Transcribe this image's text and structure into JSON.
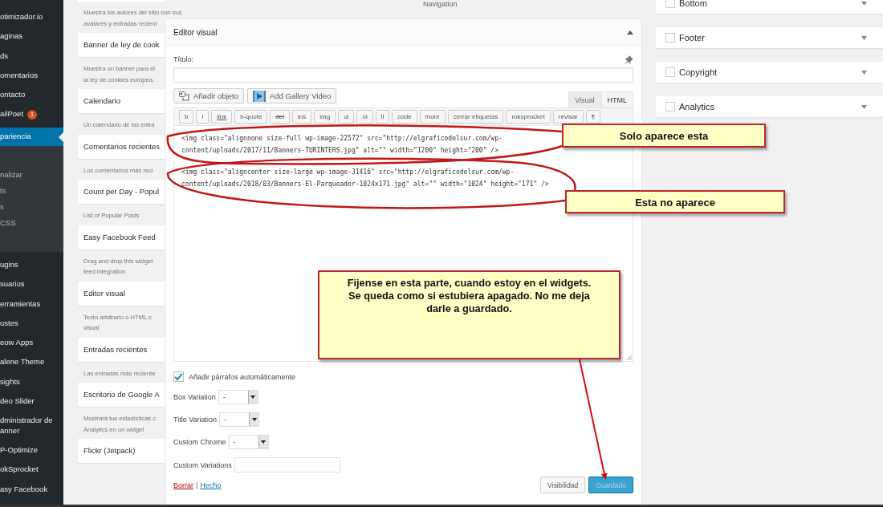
{
  "sidebar": {
    "items": [
      {
        "label": "otimizador.io",
        "selected": false
      },
      {
        "label": "aginas",
        "selected": false
      },
      {
        "label": "ds",
        "selected": false
      },
      {
        "label": "omentarios",
        "selected": false
      },
      {
        "label": "ontacto",
        "selected": false
      },
      {
        "label": "ailPoet",
        "badge": "1",
        "selected": false
      },
      {
        "label": "pariencia",
        "selected": true,
        "children": [
          {
            "label": "nalizar"
          },
          {
            "label": "ts"
          },
          {
            "label": "s"
          },
          {
            "label": "CSS"
          }
        ]
      },
      {
        "label": "ugins",
        "selected": false
      },
      {
        "label": "suarios",
        "selected": false
      },
      {
        "label": "erramientas",
        "selected": false
      },
      {
        "label": "ustes",
        "selected": false
      },
      {
        "label": "eow Apps",
        "selected": false
      },
      {
        "label": "alene Theme",
        "selected": false
      },
      {
        "label": "sights",
        "selected": false
      },
      {
        "label": "deo Slider",
        "selected": false
      },
      {
        "label": "dministrador de anner",
        "selected": false
      },
      {
        "label": "P-Optimize",
        "selected": false
      },
      {
        "label": "okSprocket",
        "selected": false
      },
      {
        "label": "asy Facebook",
        "selected": false
      }
    ]
  },
  "widgets": [
    {
      "description": [
        "Muestra los autores del sitio con sus",
        "avatares y entradas recient"
      ]
    },
    {
      "title": "Banner de ley de cook",
      "description": [
        "Muestra un banner para el",
        "la ley de cookies europea."
      ]
    },
    {
      "title": "Calendario",
      "description": [
        "Un calendario de las entra"
      ]
    },
    {
      "title": "Comentarios recientes",
      "description": [
        "Los comentarios más reci"
      ]
    },
    {
      "title": "Count per Day - Popul",
      "description": [
        "List of Popular Posts"
      ]
    },
    {
      "title": "Easy Facebook Feed",
      "description": [
        "Drag and drop this widget",
        "feed integration"
      ]
    },
    {
      "title": "Editor visual",
      "description": [
        "Texto arbitrario o HTML c",
        "visual"
      ]
    },
    {
      "title": "Entradas recientes",
      "description": [
        "Las entradas más reciente"
      ]
    },
    {
      "title": "Escritorio de Google A",
      "description": [
        "Mostrará tus estadísticas c",
        "Analytics en un widget"
      ]
    },
    {
      "title": "Flickr (Jetpack)"
    }
  ],
  "top_label": "Navigation",
  "editor": {
    "title": "Editor visual",
    "title_field": {
      "label": "Título:"
    },
    "media_buttons": [
      {
        "label": "Añadir objeto",
        "kind": "media"
      },
      {
        "label": "Add Gallery Video",
        "kind": "video"
      }
    ],
    "tabs": [
      {
        "label": "Visual",
        "selected": false
      },
      {
        "label": "HTML",
        "selected": true
      }
    ],
    "quicktags": [
      {
        "label": "b",
        "kind": "plain"
      },
      {
        "label": "i",
        "kind": "plain"
      },
      {
        "label": "link",
        "kind": "underline"
      },
      {
        "label": "b-quote",
        "kind": "plain"
      },
      {
        "label": "del",
        "kind": "strike"
      },
      {
        "label": "ins",
        "kind": "plain"
      },
      {
        "label": "img",
        "kind": "plain"
      },
      {
        "label": "ul",
        "kind": "plain"
      },
      {
        "label": "ol",
        "kind": "plain"
      },
      {
        "label": "li",
        "kind": "plain"
      },
      {
        "label": "code",
        "kind": "plain"
      },
      {
        "label": "more",
        "kind": "plain"
      },
      {
        "label": "cerrar etiquetas",
        "kind": "plain"
      },
      {
        "label": "roksprocket",
        "kind": "plain"
      },
      {
        "label": "revisar",
        "kind": "plain"
      },
      {
        "label": "¶",
        "kind": "plain"
      }
    ],
    "content": [
      "<img class=\"alignnone size-full wp-image-22572\" src=\"http://elgraficodelsur.com/wp-content/uploads/2017/11/Banners-TURINTERS.jpg\" alt=\"\" width=\"1200\" height=\"200\" />",
      "<img class=\"aligncenter size-large wp-image-31416\" src=\"http://elgraficodelsur.com/wp-content/uploads/2018/03/Banners-El-Parqueador-1024x171.jpg\" alt=\"\" width=\"1024\" height=\"171\" />"
    ],
    "auto_paragraphs": {
      "label": "Añadir párrafos automáticamente",
      "checked": true
    },
    "selects": [
      {
        "label": "Box Variation",
        "value": "-"
      },
      {
        "label": "Title Variation",
        "value": "-"
      },
      {
        "label": "Custom Chrome",
        "value": "-"
      }
    ],
    "custom_variations": {
      "label": "Custom Variations"
    },
    "links": [
      {
        "label": "Borrar",
        "kind": "delete"
      },
      {
        "label": "Hecho",
        "kind": "done"
      }
    ],
    "link_separator": "|",
    "buttons": [
      {
        "label": "Visibilidad",
        "disabled": false
      },
      {
        "label": "Guardado",
        "disabled": true
      }
    ]
  },
  "areas": [
    {
      "label": "Bottom",
      "checked": false
    },
    {
      "label": "Footer",
      "checked": false
    },
    {
      "label": "Copyright",
      "checked": false
    },
    {
      "label": "Analytics",
      "checked": false
    }
  ],
  "callouts": [
    {
      "text": "Solo aparece esta",
      "kind": "small"
    },
    {
      "text": "Esta no aparece",
      "kind": "small"
    },
    {
      "text": "Fijense en esta parte, cuando estoy en el widgets. Se queda como si estubiera apagado. No me deja darle a guardado.",
      "kind": "note"
    }
  ]
}
